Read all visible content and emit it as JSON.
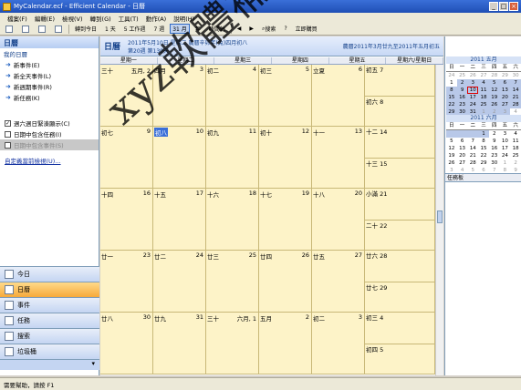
{
  "window": {
    "title": "MyCalendar.ecf - Efficient Calendar - 日曆",
    "min": "_",
    "max": "□",
    "close": "×"
  },
  "menu": [
    "檔案(F)",
    "編輯(E)",
    "檢視(V)",
    "轉到(G)",
    "工具(T)",
    "動作(A)",
    "說明(H)"
  ],
  "toolbar": {
    "today": "轉到今日",
    "day": "1 天",
    "workweek": "5 工作週",
    "week": "7 週",
    "month": "31 月",
    "year": "年",
    "timeline": "時間軸",
    "search": "搜索",
    "buy": "立即購買"
  },
  "sidebar": {
    "header": "日曆",
    "sub": "我的日曆",
    "links": [
      "新事件(E)",
      "新全天事件(L)",
      "新週期事件(R)",
      "新任務(K)"
    ],
    "checks": [
      {
        "label": "週六週日緊湊顯示(C)",
        "checked": true
      },
      {
        "label": "日期中包含任務(I)",
        "checked": false
      },
      {
        "label": "日期中包含事件(S)",
        "checked": false
      }
    ],
    "customize": "自定義當前檢視(U)...",
    "nav": [
      "今日",
      "日曆",
      "事件",
      "任務",
      "搜索",
      "垃圾桶"
    ],
    "active_nav": 1
  },
  "calendar": {
    "title": "日曆",
    "line1": "2011年5月10日 星期二 農曆辛卯年(兔)四月初八",
    "line2": "第20週 第130天",
    "right": "農曆2011年3月廿九至2011年五月初五",
    "dow": [
      "星期一",
      "星期二",
      "星期三",
      "星期四",
      "星期五",
      "星期六/星期日"
    ],
    "weeks": [
      {
        "days": [
          [
            "三十",
            "五月, 2"
          ],
          [
            "四月",
            "3"
          ],
          [
            "初二",
            "4"
          ],
          [
            "初三",
            "5"
          ],
          [
            "立夏",
            "6"
          ]
        ],
        "sat": [
          "初五",
          "7"
        ],
        "sun": [
          "初六",
          "8"
        ]
      },
      {
        "days": [
          [
            "初七",
            "9"
          ],
          [
            "初八",
            "10"
          ],
          [
            "初九",
            "11"
          ],
          [
            "初十",
            "12"
          ],
          [
            "十一",
            "13"
          ]
        ],
        "sat": [
          "十二",
          "14"
        ],
        "sun": [
          "十三",
          "15"
        ]
      },
      {
        "days": [
          [
            "十四",
            "16"
          ],
          [
            "十五",
            "17"
          ],
          [
            "十六",
            "18"
          ],
          [
            "十七",
            "19"
          ],
          [
            "十八",
            "20"
          ]
        ],
        "sat": [
          "小滿",
          "21"
        ],
        "sun": [
          "二十",
          "22"
        ]
      },
      {
        "days": [
          [
            "廿一",
            "23"
          ],
          [
            "廿二",
            "24"
          ],
          [
            "廿三",
            "25"
          ],
          [
            "廿四",
            "26"
          ],
          [
            "廿五",
            "27"
          ]
        ],
        "sat": [
          "廿六",
          "28"
        ],
        "sun": [
          "廿七",
          "29"
        ]
      },
      {
        "days": [
          [
            "廿八",
            "30"
          ],
          [
            "廿九",
            "31"
          ],
          [
            "三十",
            "六月, 1"
          ],
          [
            "五月",
            "2"
          ],
          [
            "初二",
            "3"
          ]
        ],
        "sat": [
          "初三",
          "4"
        ],
        "sun": [
          "初四",
          "5"
        ]
      }
    ]
  },
  "mini_may": {
    "title": "2011 五月",
    "dow": [
      "日",
      "一",
      "二",
      "三",
      "四",
      "五",
      "六"
    ],
    "cells": [
      "24",
      "25",
      "26",
      "27",
      "28",
      "29",
      "30",
      "1",
      "2",
      "3",
      "4",
      "5",
      "6",
      "7",
      "8",
      "9",
      "10",
      "11",
      "12",
      "13",
      "14",
      "15",
      "16",
      "17",
      "18",
      "19",
      "20",
      "21",
      "22",
      "23",
      "24",
      "25",
      "26",
      "27",
      "28",
      "29",
      "30",
      "31",
      "1",
      "2",
      "3",
      "4"
    ]
  },
  "mini_jun": {
    "title": "2011 六月",
    "dow": [
      "日",
      "一",
      "二",
      "三",
      "四",
      "五",
      "六"
    ],
    "cells": [
      "",
      "",
      "",
      "1",
      "2",
      "3",
      "4",
      "5",
      "6",
      "7",
      "8",
      "9",
      "10",
      "11",
      "12",
      "13",
      "14",
      "15",
      "16",
      "17",
      "18",
      "19",
      "20",
      "21",
      "22",
      "23",
      "24",
      "25",
      "26",
      "27",
      "28",
      "29",
      "30",
      "1",
      "2",
      "3",
      "4",
      "5",
      "6",
      "7",
      "8",
      "9"
    ]
  },
  "todo": "任務板",
  "status": "需要幫助，請按 F1",
  "watermark": "xyz軟體補給站 http://3-1-tc"
}
